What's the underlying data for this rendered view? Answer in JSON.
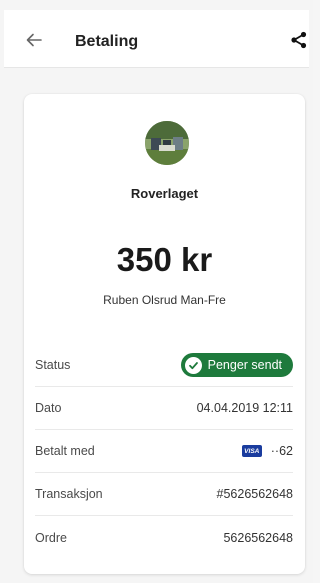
{
  "header": {
    "title": "Betaling",
    "back_icon": "arrow-left-icon",
    "share_icon": "share-icon"
  },
  "receipt": {
    "merchant": "Roverlaget",
    "amount": "350 kr",
    "payer": "Ruben Olsrud Man-Fre",
    "rows": {
      "status": {
        "label": "Status",
        "value": "Penger sendt"
      },
      "date": {
        "label": "Dato",
        "value": "04.04.2019 12:11"
      },
      "paid_with": {
        "label": "Betalt med",
        "card_brand": "VISA",
        "card_suffix": "··62"
      },
      "transaction": {
        "label": "Transaksjon",
        "value": "#5626562648"
      },
      "order": {
        "label": "Ordre",
        "value": "5626562648"
      }
    }
  },
  "colors": {
    "status_green": "#1e7a3c",
    "visa_blue": "#1a3c9e"
  }
}
